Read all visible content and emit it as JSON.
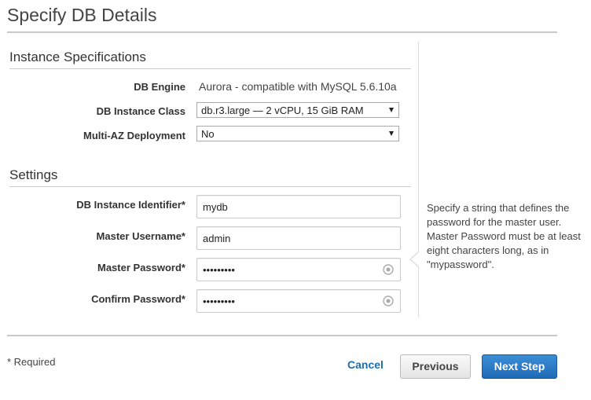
{
  "page": {
    "title": "Specify DB Details"
  },
  "instance_specs": {
    "section_title": "Instance Specifications",
    "db_engine": {
      "label": "DB Engine",
      "value": "Aurora - compatible with MySQL 5.6.10a"
    },
    "instance_class": {
      "label": "DB Instance Class",
      "selected": "db.r3.large — 2 vCPU, 15 GiB RAM"
    },
    "multi_az": {
      "label": "Multi-AZ Deployment",
      "selected": "No"
    }
  },
  "settings": {
    "section_title": "Settings",
    "identifier": {
      "label": "DB Instance Identifier*",
      "value": "mydb"
    },
    "username": {
      "label": "Master Username*",
      "value": "admin"
    },
    "password": {
      "label": "Master Password*",
      "value": "•••••••••"
    },
    "confirm_password": {
      "label": "Confirm Password*",
      "value": "•••••••••"
    }
  },
  "help_tip": {
    "text": "Specify a string that defines the password for the master user. Master Password must be at least eight characters long, as in \"mypassword\"."
  },
  "footer": {
    "required_note": "* Required",
    "cancel_label": "Cancel",
    "previous_label": "Previous",
    "next_label": "Next Step"
  },
  "colors": {
    "primary_button": "#2470bd",
    "link": "#1a6fb3",
    "rule": "#c8c8c8"
  },
  "icons": {
    "password_toggle": "eye-icon",
    "dropdown": "chevron-down-icon"
  }
}
